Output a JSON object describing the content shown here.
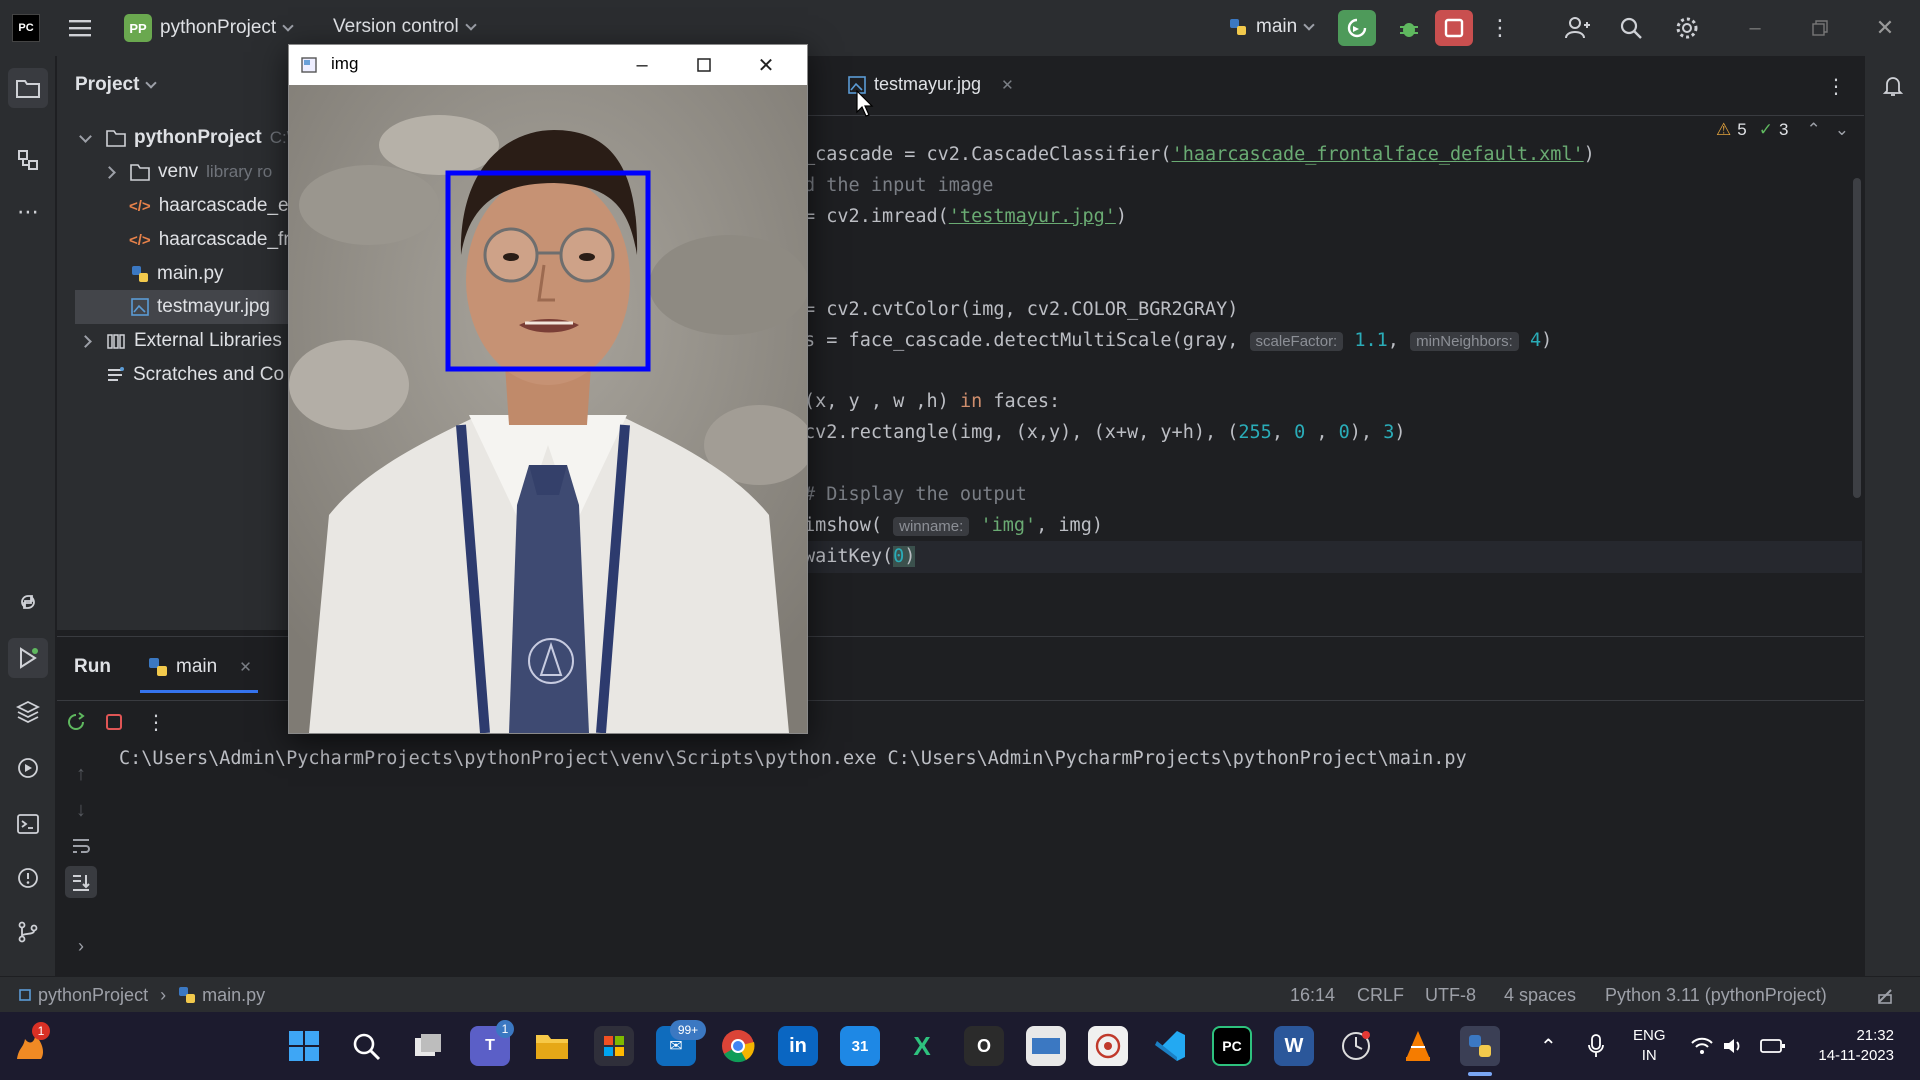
{
  "titlebar": {
    "logo": "PC",
    "project_badge": "PP",
    "project_name": "pythonProject",
    "version_control": "Version control",
    "run_config": "main"
  },
  "project_panel": {
    "title": "Project",
    "tree": [
      {
        "label": "pythonProject",
        "extra": "C:\\",
        "icon": "folder-icon"
      },
      {
        "label": "venv",
        "extra": "library ro",
        "icon": "folder-icon"
      },
      {
        "label": "haarcascade_e",
        "icon": "xml-file-icon"
      },
      {
        "label": "haarcascade_fr",
        "icon": "xml-file-icon"
      },
      {
        "label": "main.py",
        "icon": "python-file-icon"
      },
      {
        "label": "testmayur.jpg",
        "icon": "image-file-icon"
      },
      {
        "label": "External Libraries",
        "icon": "library-icon"
      },
      {
        "label": "Scratches and Co",
        "icon": "scratches-icon"
      }
    ]
  },
  "editor": {
    "tab": "testmayur.jpg",
    "inspections": {
      "warnings": "5",
      "ok": "3"
    },
    "lines": {
      "l1a": "_cascade = cv2.CascadeClassifier(",
      "l1s": "'haarcascade_frontalface_default.xml'",
      "l1b": ")",
      "l2": "d the input image",
      "l3a": "= cv2.imread(",
      "l3s": "'testmayur.jpg'",
      "l3b": ")",
      "l5": "= cv2.cvtColor(img, cv2.COLOR_BGR2GRAY)",
      "l6a": "s = face_cascade.detectMultiScale(gray, ",
      "l6h1": "scaleFactor:",
      "l6n1": "1.1",
      "l6c": ", ",
      "l6h2": "minNeighbors:",
      "l6n2": "4",
      "l6b": ")",
      "l8a": "(x, y , w ,h) ",
      "l8k": "in",
      "l8b": " faces:",
      "l9a": "cv2.rectangle(img, (x,y), (x+w, y+h), (",
      "l9n1": "255",
      "l9c1": ", ",
      "l9n2": "0",
      "l9c2": " , ",
      "l9n3": "0",
      "l9c3": "), ",
      "l9n4": "3",
      "l9b": ")",
      "l11": "# Display the output",
      "l12a": "imshow( ",
      "l12h": "winname:",
      "l12s": " 'img'",
      "l12b": ", img)",
      "l13a": "waitKey(",
      "l13n": "0",
      "l13b": ")"
    }
  },
  "image_window": {
    "title": "img"
  },
  "run_panel": {
    "label": "Run",
    "tab": "main",
    "output": "C:\\Users\\Admin\\PycharmProjects\\pythonProject\\venv\\Scripts\\python.exe C:\\Users\\Admin\\PycharmProjects\\pythonProject\\main.py"
  },
  "statusbar": {
    "project": "pythonProject",
    "file": "main.py",
    "position": "16:14",
    "line_sep": "CRLF",
    "encoding": "UTF-8",
    "indent": "4 spaces",
    "interpreter": "Python 3.11 (pythonProject)"
  },
  "taskbar": {
    "notif_badge": "1",
    "teams_badge": "1",
    "store_badge": "99+",
    "calendar_day": "31",
    "lang_top": "ENG",
    "lang_bottom": "IN",
    "time": "21:32",
    "date": "14-11-2023"
  }
}
